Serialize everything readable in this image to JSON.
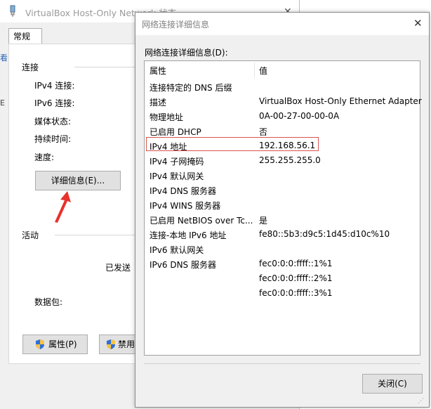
{
  "status_window": {
    "title": "VirtualBox Host-Only Network 状态",
    "tab": "常规",
    "connection_group": "连接",
    "rows": [
      "IPv4 连接:",
      "IPv6 连接:",
      "媒体状态:",
      "持续时间:",
      "速度:"
    ],
    "details_button": "详细信息(E)...",
    "activity_group": "活动",
    "sent_label": "已发送",
    "packets_label": "数据包:",
    "properties_button": "属性(P)",
    "disable_button": "禁用",
    "edge_chars": [
      "看",
      "E"
    ]
  },
  "details_dialog": {
    "title": "网络连接详细信息",
    "caption": "网络连接详细信息(D):",
    "columns": [
      "属性",
      "值"
    ],
    "rows": [
      {
        "prop": "连接特定的 DNS 后缀",
        "val": ""
      },
      {
        "prop": "描述",
        "val": "VirtualBox Host-Only Ethernet Adapter"
      },
      {
        "prop": "物理地址",
        "val": "0A-00-27-00-00-0A"
      },
      {
        "prop": "已启用 DHCP",
        "val": "否"
      },
      {
        "prop": "IPv4 地址",
        "val": "192.168.56.1"
      },
      {
        "prop": "IPv4 子网掩码",
        "val": "255.255.255.0"
      },
      {
        "prop": "IPv4 默认网关",
        "val": ""
      },
      {
        "prop": "IPv4 DNS 服务器",
        "val": ""
      },
      {
        "prop": "IPv4 WINS 服务器",
        "val": ""
      },
      {
        "prop": "已启用 NetBIOS over Tc...",
        "val": "是"
      },
      {
        "prop": "连接-本地 IPv6 地址",
        "val": "fe80::5b3:d9c5:1d45:d10c%10"
      },
      {
        "prop": "IPv6 默认网关",
        "val": ""
      },
      {
        "prop": "IPv6 DNS 服务器",
        "val": "fec0:0:0:ffff::1%1"
      },
      {
        "prop": "",
        "val": "fec0:0:0:ffff::2%1"
      },
      {
        "prop": "",
        "val": "fec0:0:0:ffff::3%1"
      }
    ],
    "close_button": "关闭(C)"
  },
  "icons": {
    "network_adapter": "network-adapter-icon",
    "close": "close-icon",
    "shield": "uac-shield-icon",
    "annotation_arrow": "red-arrow-icon"
  },
  "colors": {
    "highlight_border": "#d9534f",
    "arrow": "#e8322c"
  }
}
